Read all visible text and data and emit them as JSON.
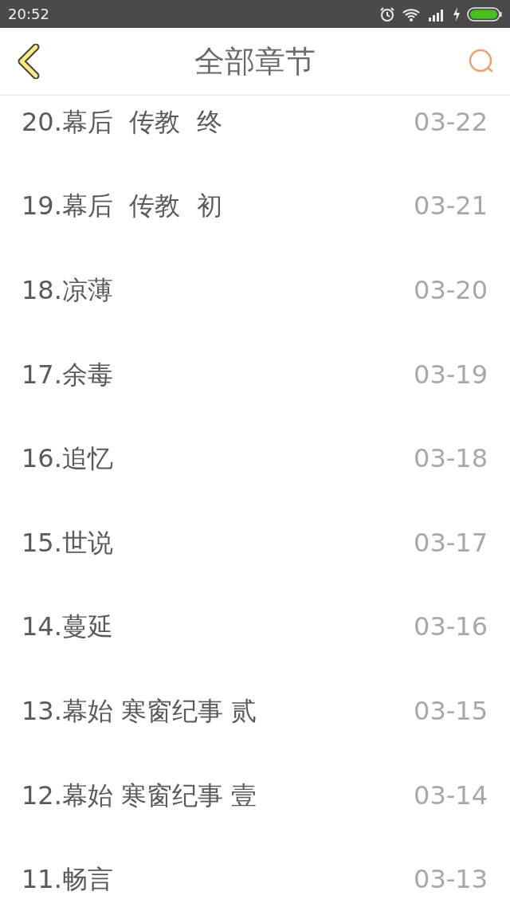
{
  "status_bar": {
    "time": "20:52"
  },
  "header": {
    "title": "全部章节"
  },
  "chapters": [
    {
      "title": "20.幕后  传教  终",
      "date": "03-22"
    },
    {
      "title": "19.幕后  传教  初",
      "date": "03-21"
    },
    {
      "title": "18.凉薄",
      "date": "03-20"
    },
    {
      "title": "17.余毒",
      "date": "03-19"
    },
    {
      "title": "16.追忆",
      "date": "03-18"
    },
    {
      "title": "15.世说",
      "date": "03-17"
    },
    {
      "title": "14.蔓延",
      "date": "03-16"
    },
    {
      "title": "13.幕始 寒窗纪事 贰",
      "date": "03-15"
    },
    {
      "title": "12.幕始 寒窗纪事 壹",
      "date": "03-14"
    },
    {
      "title": "11.畅言",
      "date": "03-13"
    }
  ]
}
